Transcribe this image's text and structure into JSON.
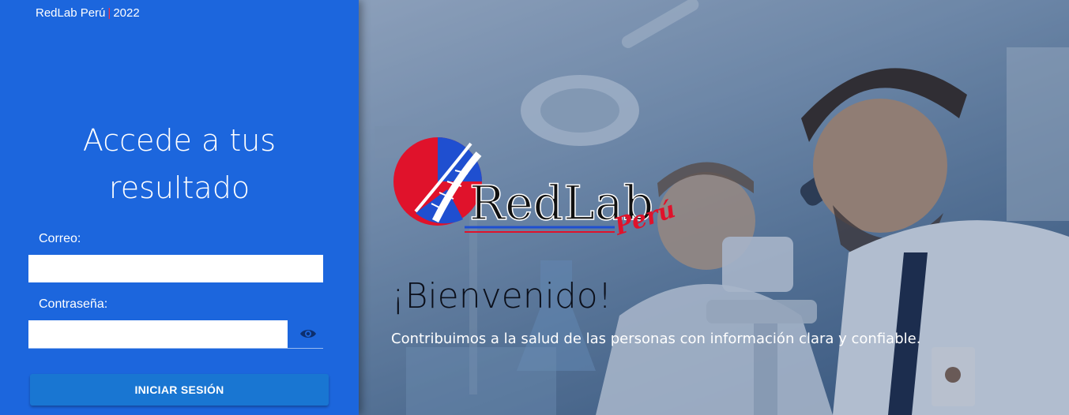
{
  "login": {
    "brand": "RedLab Perú",
    "separator": "|",
    "year": "2022",
    "title_line1": "Accede a tus",
    "title_line2": "resultado",
    "email_label": "Correo:",
    "email_value": "",
    "password_label": "Contraseña:",
    "password_value": "",
    "submit_label": "INICIAR SESIÓN",
    "eye_icon": "visibility-icon"
  },
  "hero": {
    "logo_text_main": "RedLab",
    "logo_text_script": "Perú",
    "welcome": "¡Bienvenido!",
    "tagline": "Contribuimos a la salud de las personas con información clara y confiable."
  },
  "colors": {
    "panel_bg": "#1c66dd",
    "button_bg": "#1976d2",
    "brand_red": "#e0122b",
    "separator_red": "#ff2a3a"
  }
}
